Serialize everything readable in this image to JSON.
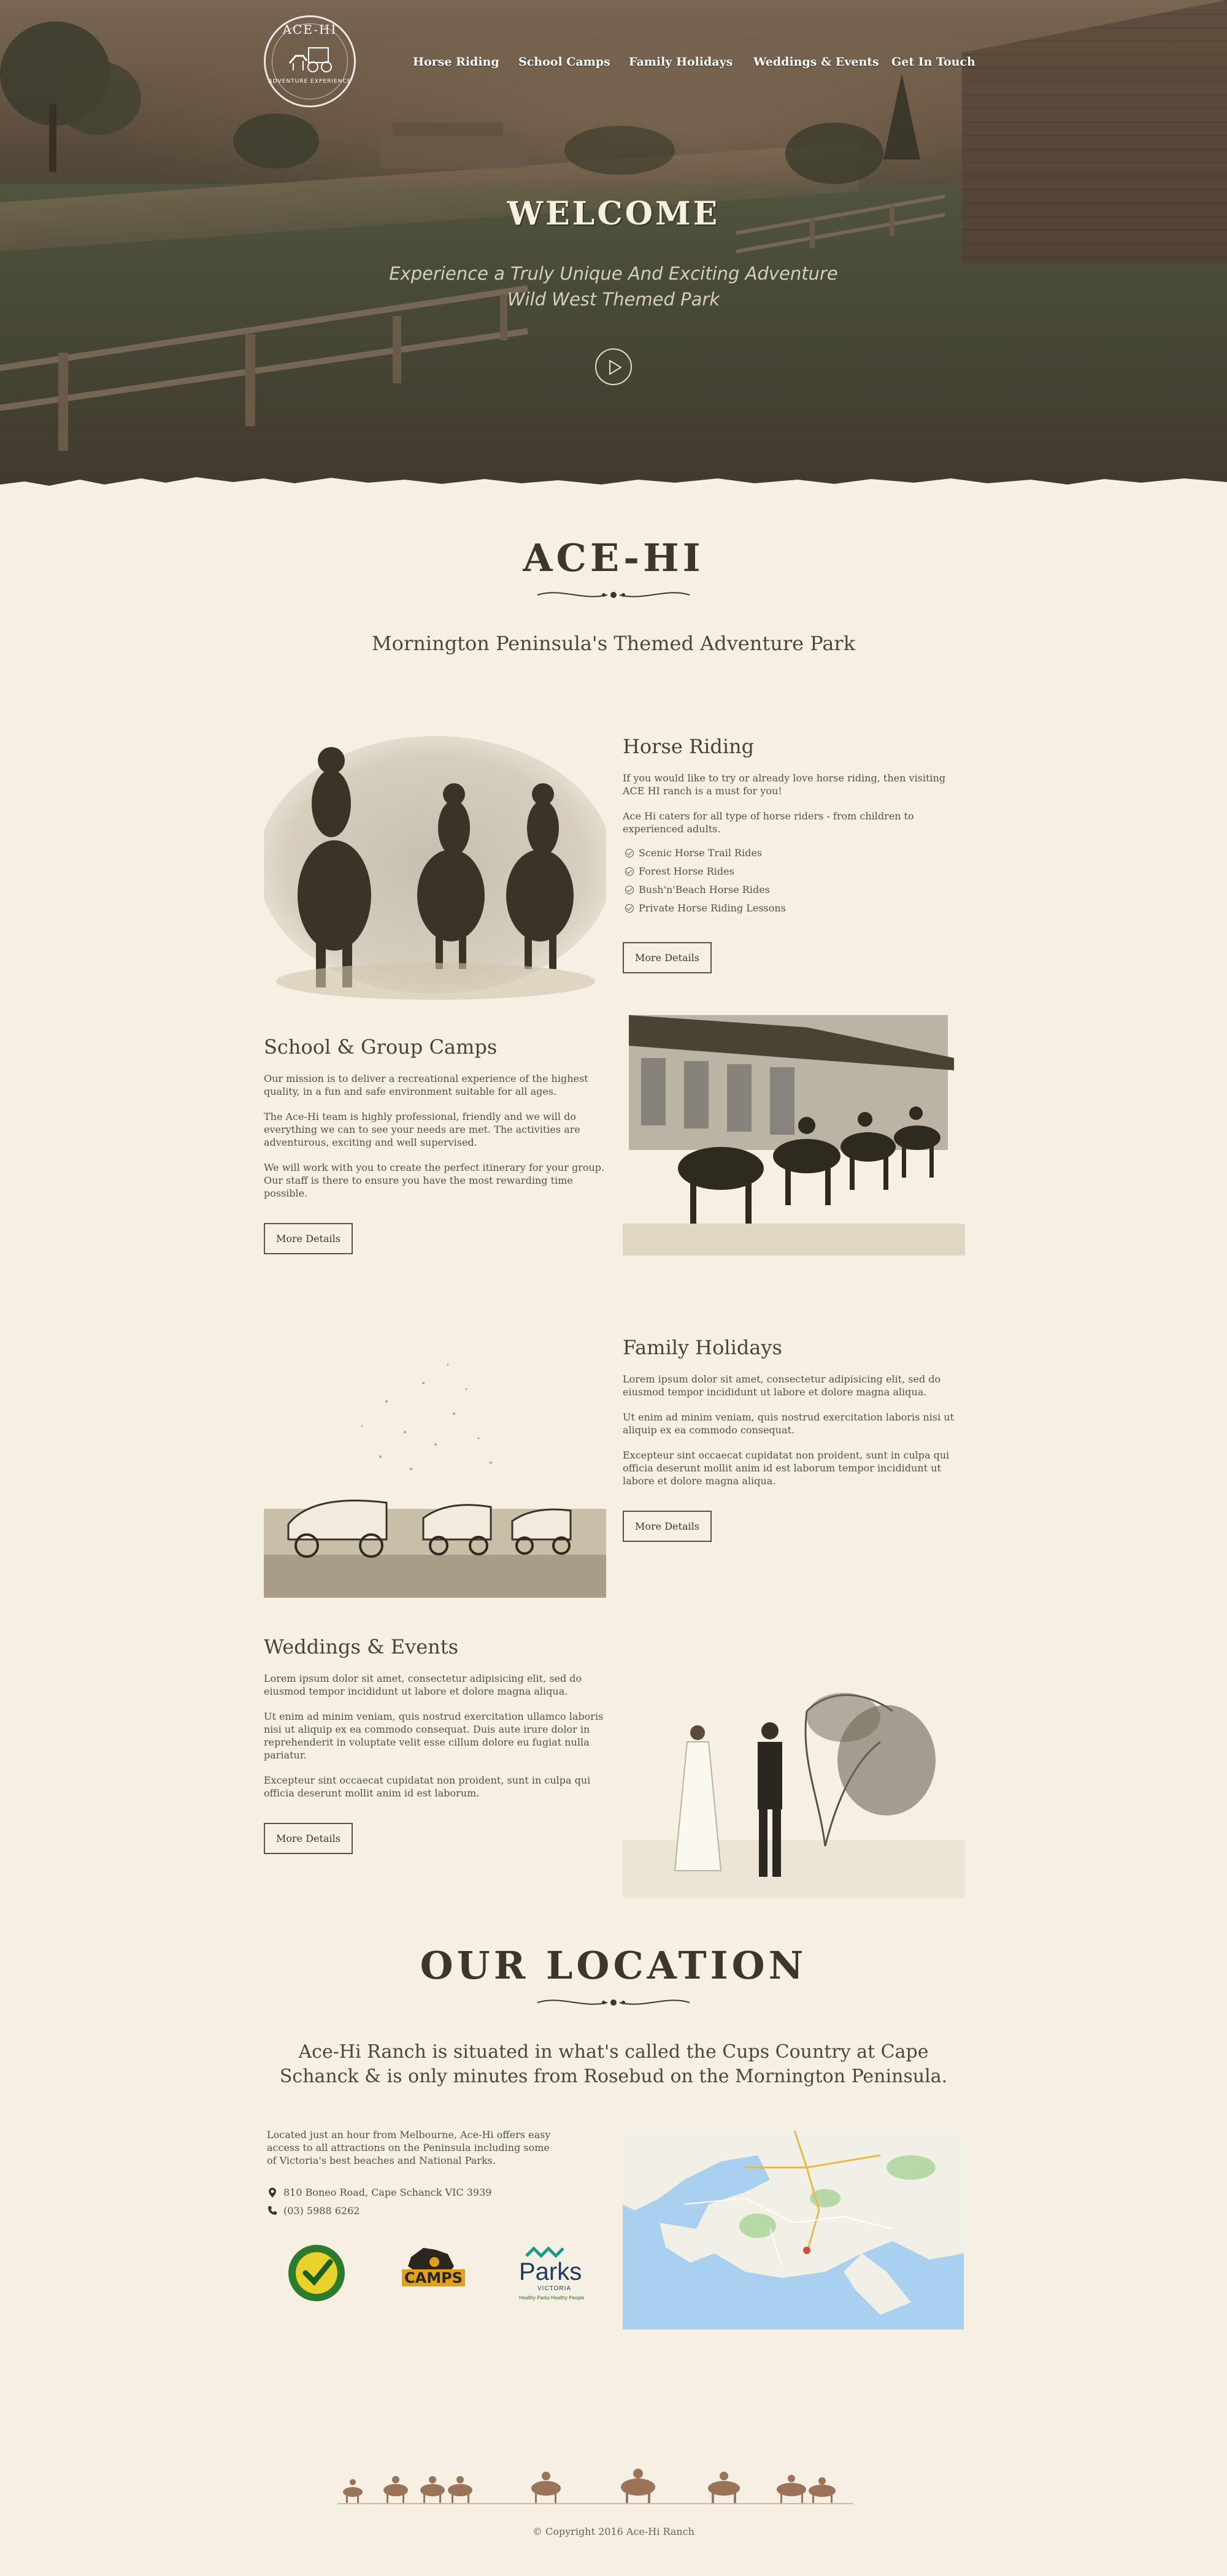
{
  "logo": {
    "title": "ACE-HI",
    "tagline": "ADVENTURE EXPERIENCE"
  },
  "nav": {
    "items": [
      {
        "label": "Horse Riding"
      },
      {
        "label": "School Camps"
      },
      {
        "label": "Family Holidays"
      },
      {
        "label": "Weddings & Events"
      },
      {
        "label": "Get In Touch"
      }
    ]
  },
  "hero": {
    "title": "WELCOME",
    "subtitle": "Experience a Truly Unique And Exciting Adventure Wild West Themed Park",
    "play_icon": "play-icon"
  },
  "intro": {
    "title": "ACE-HI",
    "subtitle": "Mornington Peninsula's Themed Adventure Park"
  },
  "features": [
    {
      "title": "Horse Riding",
      "paragraphs": [
        "If you would like to try or already love horse riding, then visiting ACE HI ranch is a must for you!",
        "Ace Hi caters for all type of horse riders - from children to experienced adults."
      ],
      "list": [
        "Scenic Horse Trail Rides",
        "Forest Horse Rides",
        "Bush'n'Beach Horse Rides",
        "Private Horse Riding Lessons"
      ],
      "button": "More Details"
    },
    {
      "title": "School & Group Camps",
      "paragraphs": [
        "Our mission is to deliver a recreational experience of the highest quality, in a fun and safe environment suitable for all ages.",
        "The Ace-Hi team is highly professional, friendly and we will do everything we can to see your needs are met. The activities are adventurous, exciting and well supervised.",
        "We will work with you to create the perfect itinerary for your group. Our staff is there to ensure you have the most rewarding time possible."
      ],
      "button": "More Details"
    },
    {
      "title": "Family Holidays",
      "paragraphs": [
        "Lorem ipsum dolor sit amet, consectetur adipisicing elit, sed do eiusmod tempor incididunt ut labore et dolore magna aliqua.",
        "Ut enim ad minim veniam, quis nostrud exercitation laboris nisi ut aliquip ex ea commodo consequat.",
        "Excepteur sint occaecat cupidatat non proident, sunt in culpa qui officia deserunt mollit anim id est laborum tempor incididunt ut labore et dolore magna aliqua."
      ],
      "button": "More Details"
    },
    {
      "title": "Weddings & Events",
      "paragraphs": [
        "Lorem ipsum dolor sit amet, consectetur adipisicing elit, sed do eiusmod tempor incididunt ut labore et dolore magna aliqua.",
        "Ut enim ad minim veniam, quis nostrud exercitation ullamco laboris nisi ut aliquip ex ea commodo consequat. Duis aute irure dolor in reprehenderit in voluptate velit esse cillum dolore eu fugiat nulla pariatur.",
        "Excepteur sint occaecat cupidatat non proident, sunt in culpa qui officia deserunt mollit anim id est laborum."
      ],
      "button": "More Details"
    }
  ],
  "location": {
    "title": "OUR LOCATION",
    "subtitle": "Ace-Hi Ranch is situated in what's called the Cups Country at Cape Schanck & is only minutes from Rosebud on the Mornington Peninsula.",
    "description": "Located just an hour from Melbourne, Ace-Hi offers easy access to all attractions on the Peninsula including some of Victoria's best beaches and National Parks.",
    "address": "810 Boneo Road, Cape Schanck VIC 3939",
    "phone": "(03) 5988 6262",
    "address_icon": "map-pin-icon",
    "phone_icon": "phone-icon",
    "badges": [
      {
        "name": "accredited-badge"
      },
      {
        "name": "camps-australia-badge",
        "text": "CAMPS"
      },
      {
        "name": "parks-victoria-badge",
        "text": "Parks",
        "sub": "VICTORIA",
        "tag": "Healthy Parks Healthy People"
      }
    ]
  },
  "footer": {
    "copyright": "© Copyright 2016 Ace-Hi Ranch"
  },
  "colors": {
    "page_bg": "#f6efe3",
    "text": "#4a4236",
    "heading": "#3e362c",
    "map_water": "#aad0f0",
    "map_land": "#f1efe6"
  }
}
